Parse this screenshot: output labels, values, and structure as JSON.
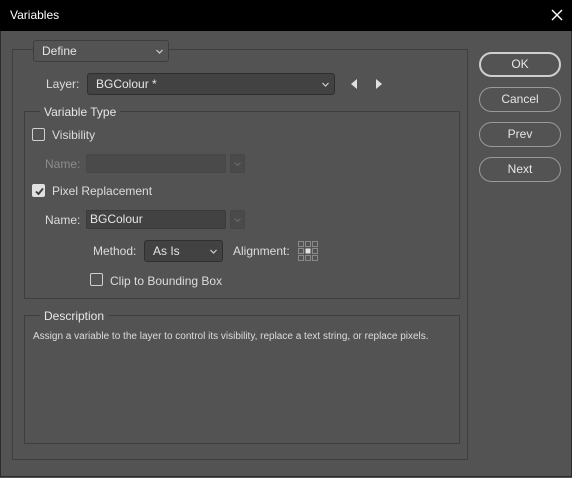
{
  "window": {
    "title": "Variables"
  },
  "mode": {
    "selected": "Define"
  },
  "layer": {
    "label": "Layer:",
    "value": "BGColour *"
  },
  "variable_type": {
    "title": "Variable Type",
    "visibility": {
      "label": "Visibility",
      "checked": false,
      "name_label": "Name:",
      "name_value": ""
    },
    "pixel_replacement": {
      "label": "Pixel Replacement",
      "checked": true,
      "name_label": "Name:",
      "name_value": "BGColour"
    },
    "method": {
      "label": "Method:",
      "value": "As Is"
    },
    "alignment": {
      "label": "Alignment:"
    },
    "clip": {
      "label": "Clip to Bounding Box",
      "checked": false
    }
  },
  "description": {
    "title": "Description",
    "text": "Assign a variable to the layer to control its visibility, replace a text string, or replace pixels."
  },
  "buttons": {
    "ok": "OK",
    "cancel": "Cancel",
    "prev": "Prev",
    "next": "Next"
  },
  "icons": [
    "close-icon",
    "chevron-down-icon",
    "arrow-left-icon",
    "arrow-right-icon",
    "checkmark-icon",
    "alignment-grid-icon"
  ]
}
